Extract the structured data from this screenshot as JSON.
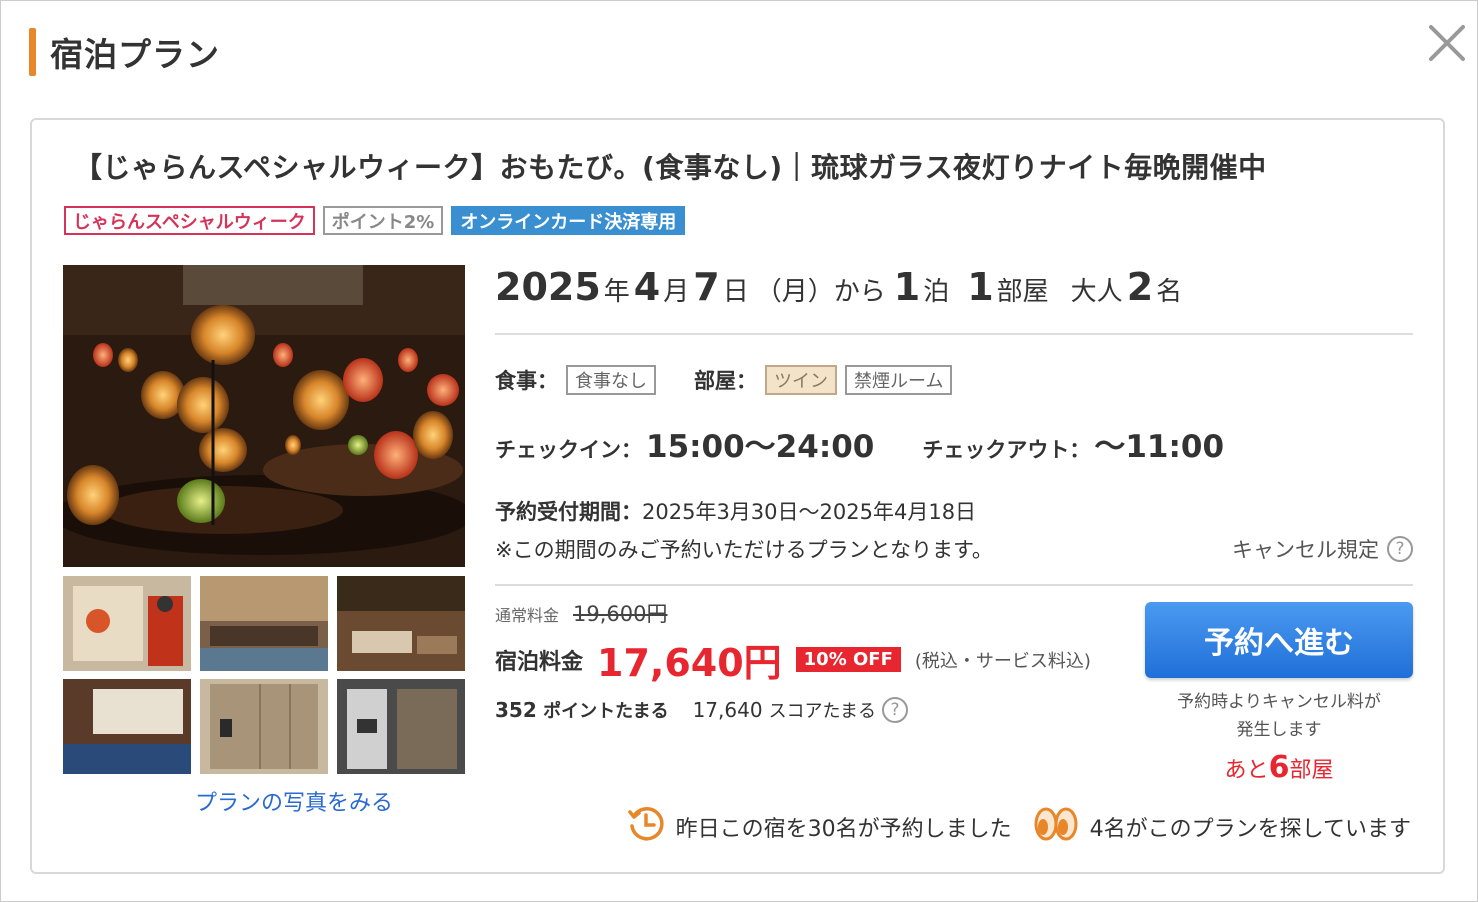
{
  "modal": {
    "title": "宿泊プラン"
  },
  "plan": {
    "title": "【じゃらんスペシャルウィーク】おもたび。(食事なし)｜琉球ガラス夜灯りナイト毎晩開催中",
    "tags": [
      "じゃらんスペシャルウィーク",
      "ポイント2%",
      "オンラインカード決済専用"
    ],
    "photos_link": "プランの写真をみる"
  },
  "booking": {
    "year": "2025",
    "year_unit": "年",
    "month": "4",
    "month_unit": "月",
    "day": "7",
    "day_unit": "日",
    "weekday": "（月）から",
    "nights": "1",
    "nights_unit": "泊",
    "rooms": "1",
    "rooms_unit": "部屋",
    "adults_label": "大人",
    "adults": "2",
    "adults_unit": "名"
  },
  "details": {
    "meal_label": "食事：",
    "meal_value": "食事なし",
    "room_label": "部屋：",
    "room_chips": [
      "ツイン",
      "禁煙ルーム"
    ],
    "checkin_label": "チェックイン：",
    "checkin_time": "15:00〜24:00",
    "checkout_label": "チェックアウト：",
    "checkout_time": "〜11:00",
    "period_label": "予約受付期間：",
    "period_value": "2025年3月30日〜2025年4月18日",
    "period_note": "※この期間のみご予約いただけるプランとなります。",
    "cancel_policy": "キャンセル規定"
  },
  "pricing": {
    "regular_label": "通常料金",
    "regular_price": "19,600円",
    "stay_label": "宿泊料金",
    "stay_price": "17,640円",
    "discount_badge": "10% OFF",
    "tax_note": "(税込・サービス料込)",
    "points_value": "352",
    "points_label": "ポイントたまる",
    "score_value": "17,640",
    "score_label": "スコアたまる"
  },
  "reserve": {
    "button_label": "予約へ進む",
    "note_line1": "予約時よりキャンセル料が",
    "note_line2": "発生します",
    "rooms_left_prefix": "あと",
    "rooms_left_count": "6",
    "rooms_left_suffix": "部屋"
  },
  "activity": {
    "booked_text": "昨日この宿を30名が予約しました",
    "viewing_text": "4名がこのプランを探しています"
  },
  "colors": {
    "accent": "#e8862a",
    "price_red": "#e8262f",
    "button_blue": "#1f6fd9",
    "link_blue": "#2a6ad1"
  }
}
